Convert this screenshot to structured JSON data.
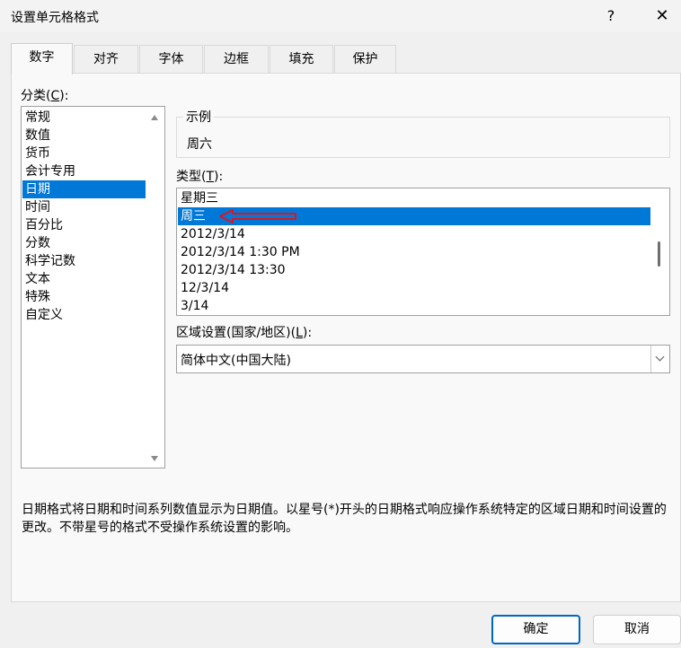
{
  "window": {
    "title": "设置单元格格式",
    "help_glyph": "?",
    "close_glyph": "✕"
  },
  "tabs": [
    {
      "label": "数字",
      "active": true
    },
    {
      "label": "对齐",
      "active": false
    },
    {
      "label": "字体",
      "active": false
    },
    {
      "label": "边框",
      "active": false
    },
    {
      "label": "填充",
      "active": false
    },
    {
      "label": "保护",
      "active": false
    }
  ],
  "category": {
    "label_prefix": "分类(",
    "label_key": "C",
    "label_suffix": "):",
    "items": [
      "常规",
      "数值",
      "货币",
      "会计专用",
      "日期",
      "时间",
      "百分比",
      "分数",
      "科学记数",
      "文本",
      "特殊",
      "自定义"
    ],
    "selected": "日期"
  },
  "sample": {
    "legend": "示例",
    "value": "周六"
  },
  "type": {
    "label_prefix": "类型(",
    "label_key": "T",
    "label_suffix": "):",
    "items": [
      "星期三",
      "周三",
      "2012/3/14",
      "2012/3/14 1:30 PM",
      "2012/3/14 13:30",
      "12/3/14",
      "3/14"
    ],
    "selected": "周三"
  },
  "locale": {
    "label_prefix": "区域设置(国家/地区)(",
    "label_key": "L",
    "label_suffix": "):",
    "value": "简体中文(中国大陆)"
  },
  "description": "日期格式将日期和时间系列数值显示为日期值。以星号(*)开头的日期格式响应操作系统特定的区域日期和时间设置的更改。不带星号的格式不受操作系统设置的影响。",
  "buttons": {
    "ok": "确定",
    "cancel": "取消"
  },
  "colors": {
    "selection": "#0078d7",
    "annotation_arrow": "#e0141e",
    "primary_border": "#0067c0"
  },
  "icons": {
    "help": "help-icon",
    "close": "close-icon",
    "scroll_up": "scroll-up-arrow-icon",
    "scroll_down": "scroll-down-arrow-icon",
    "dropdown": "chevron-down-icon",
    "annotation": "red-arrow-icon"
  }
}
